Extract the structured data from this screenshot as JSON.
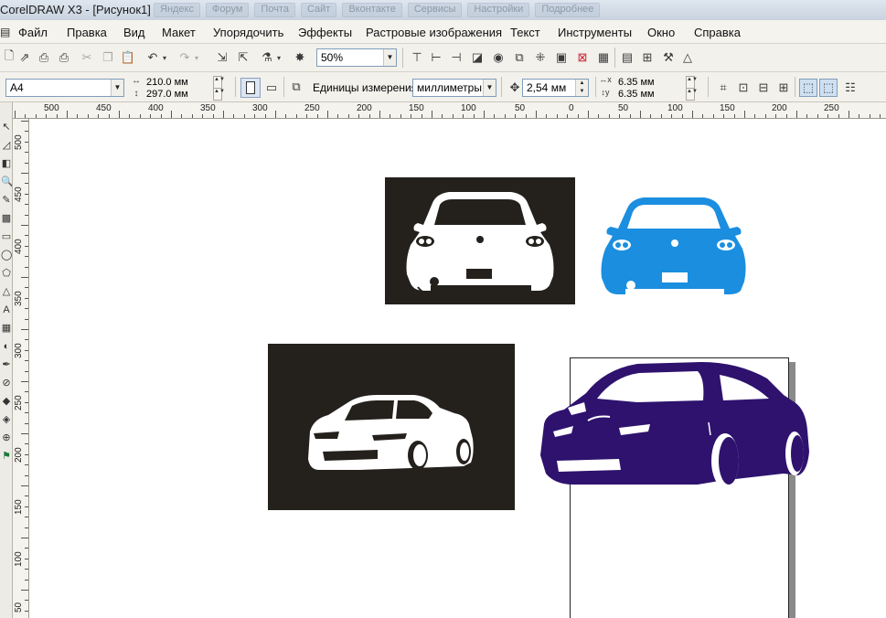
{
  "window": {
    "title": "CorelDRAW X3 - [Рисунок1]",
    "background_tabs": [
      "Яндекс",
      "Форум",
      "Почта",
      "Сайт",
      "Вконтакте",
      "Сервисы",
      "Настройки",
      "Подробнее"
    ]
  },
  "menu": {
    "items": [
      "Файл",
      "Правка",
      "Вид",
      "Макет",
      "Упорядочить",
      "Эффекты",
      "Растровые изображения",
      "Текст",
      "Инструменты",
      "Окно",
      "Справка"
    ]
  },
  "toolbar_standard": {
    "zoom_value": "50%"
  },
  "property_bar": {
    "paper_size": "A4",
    "page_width": "210.0 мм",
    "page_height": "297.0 мм",
    "units_label": "Единицы измерения:",
    "units_value": "миллиметры",
    "nudge_value": "2,54 мм",
    "duplicate_x": "6.35 мм",
    "duplicate_y": "6.35 мм"
  },
  "ruler_top": {
    "labels": [
      "500",
      "450",
      "400",
      "350",
      "300",
      "250",
      "200",
      "150",
      "100",
      "50",
      "0",
      "50",
      "100",
      "150",
      "200",
      "250"
    ]
  },
  "ruler_left": {
    "labels": [
      "500",
      "450",
      "400",
      "350",
      "300",
      "250",
      "200",
      "150",
      "100",
      "50"
    ]
  },
  "artwork": {
    "colors": {
      "dark_panel": "#24211c",
      "white_car": "#ffffff",
      "blue_car": "#1b8ee0",
      "purple_car": "#2e126e"
    },
    "objects": [
      "white-car-rear-on-dark-panel",
      "blue-car-rear",
      "white-car-front-on-dark-panel",
      "purple-car-front"
    ]
  }
}
